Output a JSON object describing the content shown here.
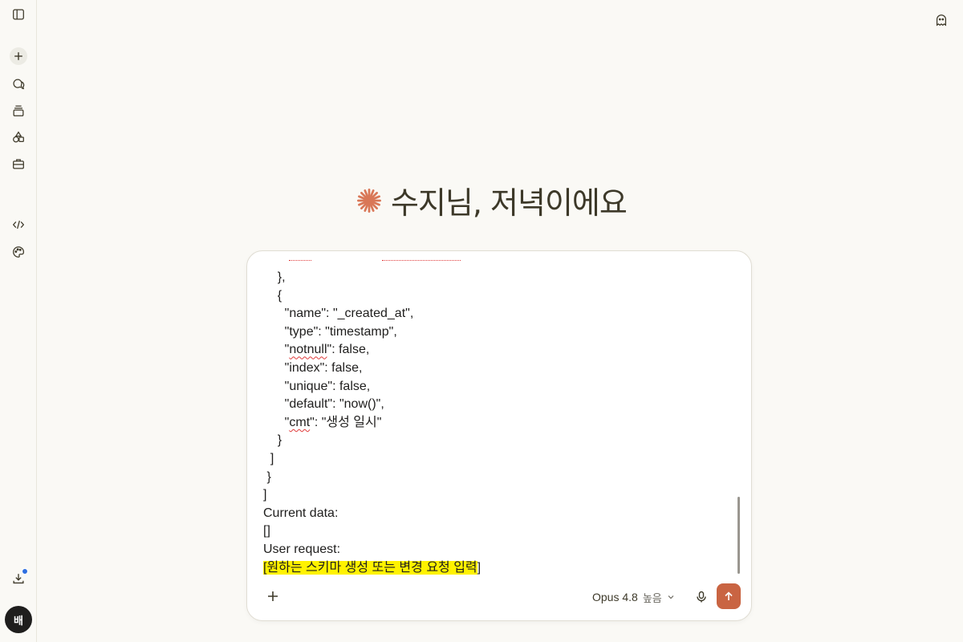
{
  "user": {
    "avatar_initial": "배"
  },
  "greeting": "수지님, 저녁이에요",
  "editor": {
    "lines": [
      "    },",
      "    {",
      "      \"name\": \"_created_at\",",
      "      \"type\": \"timestamp\",",
      "      \"notnull\": false,",
      "      \"index\": false,",
      "      \"unique\": false,",
      "      \"default\": \"now()\",",
      "      \"cmt\": \"생성 일시\"",
      "    }",
      "  ]",
      " }",
      "]",
      "Current data:",
      "[]",
      "User request:"
    ],
    "request_open": "[",
    "request_text": "원하는 스키마 생성 또는 변경 요청 입력",
    "request_close": "]"
  },
  "composer": {
    "model": "Opus 4.8",
    "effort": "높음"
  },
  "colors": {
    "accent": "#c96442",
    "highlight": "#fff200",
    "spell_error": "#e03a3a"
  },
  "icons": [
    "sidebar-toggle-icon",
    "new-chat-icon",
    "chats-icon",
    "projects-icon",
    "artifacts-icon",
    "toolkit-icon",
    "code-icon",
    "palette-icon",
    "download-icon",
    "ghost-icon",
    "spark-icon",
    "plus-icon",
    "chevron-down-icon",
    "mic-icon",
    "arrow-up-icon"
  ]
}
